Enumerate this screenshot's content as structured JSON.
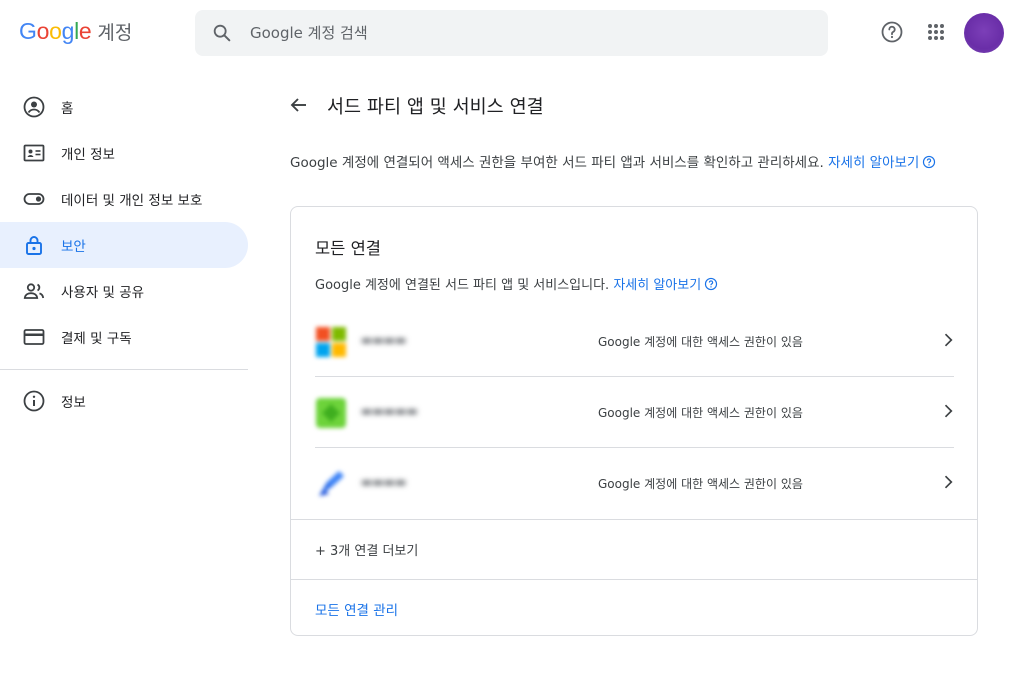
{
  "header": {
    "logo_word": "Google",
    "product": "계정",
    "search_placeholder": "Google 계정 검색",
    "help_icon": "help-circle-icon",
    "apps_icon": "apps-grid-icon",
    "avatar_color": "#6a2ea8"
  },
  "sidebar": {
    "items": [
      {
        "label": "홈",
        "icon": "account-circle-icon"
      },
      {
        "label": "개인 정보",
        "icon": "id-card-icon"
      },
      {
        "label": "데이터 및 개인 정보 보호",
        "icon": "toggle-icon"
      },
      {
        "label": "보안",
        "icon": "lock-icon",
        "active": true
      },
      {
        "label": "사용자 및 공유",
        "icon": "people-icon"
      },
      {
        "label": "결제 및 구독",
        "icon": "credit-card-icon"
      }
    ],
    "info": {
      "label": "정보",
      "icon": "info-icon"
    }
  },
  "main": {
    "title": "서드 파티 앱 및 서비스 연결",
    "description": "Google 계정에 연결되어 액세스 권한을 부여한 서드 파티 앱과 서비스를 확인하고 관리하세요.",
    "learn_more": "자세히 알아보기"
  },
  "card": {
    "title": "모든 연결",
    "subtitle": "Google 계정에 연결된 서드 파티 앱 및 서비스입니다.",
    "learn_more": "자세히 알아보기",
    "connections": [
      {
        "access": "Google 계정에 대한 액세스 권한이 있음"
      },
      {
        "access": "Google 계정에 대한 액세스 권한이 있음"
      },
      {
        "access": "Google 계정에 대한 액세스 권한이 있음"
      }
    ],
    "more_label": "+ 3개 연결 더보기",
    "manage_label": "모든 연결 관리"
  },
  "colors": {
    "accent": "#1a73e8",
    "active_bg": "#e8f0fe",
    "divider": "#dadce0"
  }
}
